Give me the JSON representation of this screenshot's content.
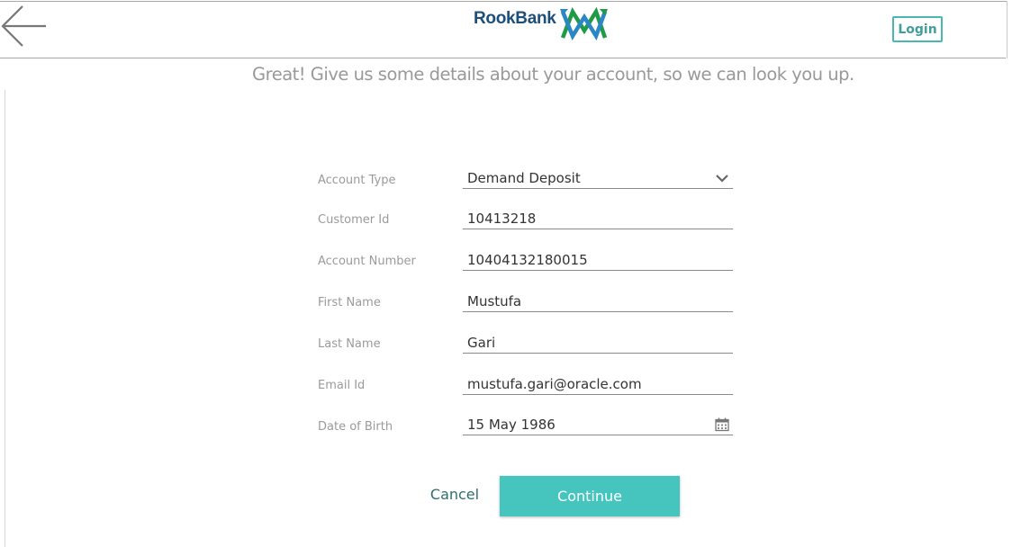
{
  "header": {
    "logo_text": "RookBank",
    "login_label": "Login",
    "accent_color": "#45c5be",
    "icons": [
      "back-arrow-icon",
      "rookbank-logo-icon"
    ]
  },
  "main": {
    "subtitle": "Great! Give us some details about your account, so we can look you up."
  },
  "form": {
    "fields": [
      {
        "label": "Account Type",
        "value": "Demand Deposit",
        "icon": "chevron-down-icon"
      },
      {
        "label": "Customer Id",
        "value": "10413218"
      },
      {
        "label": "Account Number",
        "value": "10404132180015"
      },
      {
        "label": "First Name",
        "value": "Mustufa"
      },
      {
        "label": "Last Name",
        "value": "Gari"
      },
      {
        "label": "Email Id",
        "value": "mustufa.gari@oracle.com"
      },
      {
        "label": "Date of Birth",
        "value": "15 May 1986",
        "icon": "calendar-icon"
      }
    ]
  },
  "actions": {
    "cancel_label": "Cancel",
    "continue_label": "Continue"
  }
}
